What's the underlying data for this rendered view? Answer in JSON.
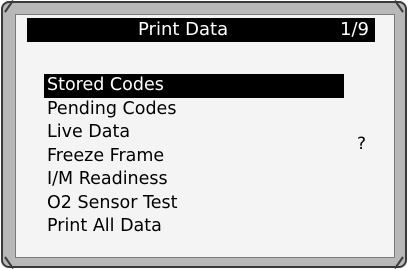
{
  "header": {
    "title": "Print Data",
    "page": "1/9"
  },
  "menu": {
    "items": [
      {
        "label": "Stored Codes"
      },
      {
        "label": "Pending Codes"
      },
      {
        "label": "Live Data"
      },
      {
        "label": "Freeze Frame"
      },
      {
        "label": "I/M Readiness"
      },
      {
        "label": "O2 Sensor Test"
      },
      {
        "label": "Print All Data"
      }
    ],
    "selected_index": 0
  },
  "help_icon": {
    "glyph": "?",
    "icon": "help-icon"
  },
  "colors": {
    "device_body": "#b8b8b8",
    "screen_background": "#f4f4f4",
    "highlight": "#000000",
    "highlight_text": "#ffffff"
  }
}
